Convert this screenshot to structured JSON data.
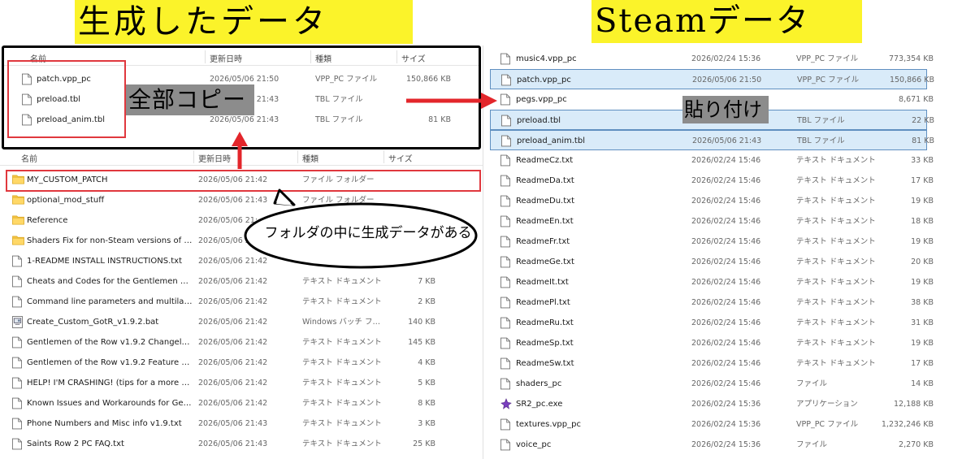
{
  "titles": {
    "left": "生成したデータ",
    "right": "Steamデータ"
  },
  "annotations": {
    "copy_all": "全部コピー",
    "paste": "貼り付け",
    "callout": "フォルダの中に生成データがある"
  },
  "columns": {
    "name": "名前",
    "date": "更新日時",
    "type": "種類",
    "size": "サイズ"
  },
  "popup_files": [
    {
      "name": "patch.vpp_pc",
      "date": "2026/05/06 21:50",
      "type": "VPP_PC ファイル",
      "size": "150,866 KB"
    },
    {
      "name": "preload.tbl",
      "date": "2026/05/06 21:43",
      "type": "TBL ファイル",
      "size": ""
    },
    {
      "name": "preload_anim.tbl",
      "date": "2026/05/06 21:43",
      "type": "TBL ファイル",
      "size": "81 KB"
    }
  ],
  "left_files": [
    {
      "name": "MY_CUSTOM_PATCH",
      "date": "2026/05/06 21:42",
      "type": "ファイル フォルダー",
      "size": "",
      "icon": "folder-icon"
    },
    {
      "name": "optional_mod_stuff",
      "date": "2026/05/06 21:43",
      "type": "ファイル フォルダー",
      "size": "",
      "icon": "folder-icon"
    },
    {
      "name": "Reference",
      "date": "2026/05/06 21:",
      "type": "",
      "size": "",
      "icon": "folder-icon"
    },
    {
      "name": "Shaders Fix for non-Steam versions of SR...",
      "date": "2026/05/06 21:",
      "type": "",
      "size": "",
      "icon": "folder-icon"
    },
    {
      "name": "1-README INSTALL INSTRUCTIONS.txt",
      "date": "2026/05/06 21:42",
      "type": "",
      "size": "",
      "icon": "document-icon"
    },
    {
      "name": "Cheats and Codes for the Gentlemen of t...",
      "date": "2026/05/06 21:42",
      "type": "テキスト ドキュメント",
      "size": "7 KB",
      "icon": "document-icon"
    },
    {
      "name": "Command line parameters and multilang...",
      "date": "2026/05/06 21:42",
      "type": "テキスト ドキュメント",
      "size": "2 KB",
      "icon": "document-icon"
    },
    {
      "name": "Create_Custom_GotR_v1.9.2.bat",
      "date": "2026/05/06 21:42",
      "type": "Windows バッチ ファ...",
      "size": "140 KB",
      "icon": "batch-file-icon"
    },
    {
      "name": "Gentlemen of the Row v1.9.2 Changelog.t...",
      "date": "2026/05/06 21:42",
      "type": "テキスト ドキュメント",
      "size": "145 KB",
      "icon": "document-icon"
    },
    {
      "name": "Gentlemen of the Row v1.9.2 Feature List....",
      "date": "2026/05/06 21:42",
      "type": "テキスト ドキュメント",
      "size": "4 KB",
      "icon": "document-icon"
    },
    {
      "name": "HELP! I'M CRASHING! (tips for a more sta...",
      "date": "2026/05/06 21:42",
      "type": "テキスト ドキュメント",
      "size": "5 KB",
      "icon": "document-icon"
    },
    {
      "name": "Known Issues and Workarounds for Gentl...",
      "date": "2026/05/06 21:42",
      "type": "テキスト ドキュメント",
      "size": "8 KB",
      "icon": "document-icon"
    },
    {
      "name": "Phone Numbers and Misc info v1.9.txt",
      "date": "2026/05/06 21:43",
      "type": "テキスト ドキュメント",
      "size": "3 KB",
      "icon": "document-icon"
    },
    {
      "name": "Saints Row 2 PC FAQ.txt",
      "date": "2026/05/06 21:43",
      "type": "テキスト ドキュメント",
      "size": "25 KB",
      "icon": "document-icon"
    }
  ],
  "right_files": [
    {
      "name": "music4.vpp_pc",
      "date": "2026/02/24 15:36",
      "type": "VPP_PC ファイル",
      "size": "773,354 KB",
      "hl": false
    },
    {
      "name": "patch.vpp_pc",
      "date": "2026/05/06 21:50",
      "type": "VPP_PC ファイル",
      "size": "150,866 KB",
      "hl": true
    },
    {
      "name": "pegs.vpp_pc",
      "date": "",
      "type": "",
      "size": "8,671 KB",
      "hl": false
    },
    {
      "name": "preload.tbl",
      "date": "2026/05/06 21:43",
      "type": "TBL ファイル",
      "size": "22 KB",
      "hl": true
    },
    {
      "name": "preload_anim.tbl",
      "date": "2026/05/06 21:43",
      "type": "TBL ファイル",
      "size": "81 KB",
      "hl": true
    },
    {
      "name": "ReadmeCz.txt",
      "date": "2026/02/24 15:46",
      "type": "テキスト ドキュメント",
      "size": "33 KB",
      "hl": false
    },
    {
      "name": "ReadmeDa.txt",
      "date": "2026/02/24 15:46",
      "type": "テキスト ドキュメント",
      "size": "17 KB",
      "hl": false
    },
    {
      "name": "ReadmeDu.txt",
      "date": "2026/02/24 15:46",
      "type": "テキスト ドキュメント",
      "size": "19 KB",
      "hl": false
    },
    {
      "name": "ReadmeEn.txt",
      "date": "2026/02/24 15:46",
      "type": "テキスト ドキュメント",
      "size": "18 KB",
      "hl": false
    },
    {
      "name": "ReadmeFr.txt",
      "date": "2026/02/24 15:46",
      "type": "テキスト ドキュメント",
      "size": "19 KB",
      "hl": false
    },
    {
      "name": "ReadmeGe.txt",
      "date": "2026/02/24 15:46",
      "type": "テキスト ドキュメント",
      "size": "20 KB",
      "hl": false
    },
    {
      "name": "ReadmeIt.txt",
      "date": "2026/02/24 15:46",
      "type": "テキスト ドキュメント",
      "size": "19 KB",
      "hl": false
    },
    {
      "name": "ReadmePl.txt",
      "date": "2026/02/24 15:46",
      "type": "テキスト ドキュメント",
      "size": "38 KB",
      "hl": false
    },
    {
      "name": "ReadmeRu.txt",
      "date": "2026/02/24 15:46",
      "type": "テキスト ドキュメント",
      "size": "31 KB",
      "hl": false
    },
    {
      "name": "ReadmeSp.txt",
      "date": "2026/02/24 15:46",
      "type": "テキスト ドキュメント",
      "size": "19 KB",
      "hl": false
    },
    {
      "name": "ReadmeSw.txt",
      "date": "2026/02/24 15:46",
      "type": "テキスト ドキュメント",
      "size": "17 KB",
      "hl": false
    },
    {
      "name": "shaders_pc",
      "date": "2026/02/24 15:46",
      "type": "ファイル",
      "size": "14 KB",
      "hl": false
    },
    {
      "name": "SR2_pc.exe",
      "date": "2026/02/24 15:36",
      "type": "アプリケーション",
      "size": "12,188 KB",
      "hl": false
    },
    {
      "name": "textures.vpp_pc",
      "date": "2026/02/24 15:36",
      "type": "VPP_PC ファイル",
      "size": "1,232,246 KB",
      "hl": false
    },
    {
      "name": "voice_pc",
      "date": "2026/02/24 15:36",
      "type": "ファイル",
      "size": "2,270 KB",
      "hl": false
    }
  ],
  "colors": {
    "banner": "#fbf32a",
    "red": "#e0383e",
    "label_bg": "#8c8c8c",
    "highlight": "#d9ebf9",
    "folder": "#f5c542"
  }
}
